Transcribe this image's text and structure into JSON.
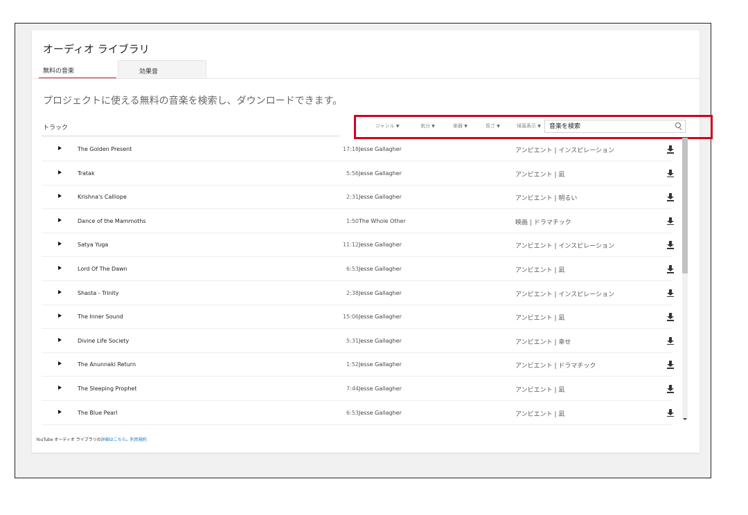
{
  "library": {
    "title": "オーディオ ライブラリ",
    "tabs": [
      {
        "label": "無料の音楽",
        "active": true
      },
      {
        "label": "効果音",
        "active": false
      }
    ],
    "description": "プロジェクトに使える無料の音楽を検索し、ダウンロードできます。"
  },
  "list_header": {
    "track_label": "トラック"
  },
  "filters": [
    {
      "label": "ジャンル"
    },
    {
      "label": "気分"
    },
    {
      "label": "楽器"
    },
    {
      "label": "長さ"
    },
    {
      "label": "帰属表示"
    }
  ],
  "search": {
    "placeholder": "音楽を検索"
  },
  "tracks": [
    {
      "title": "The Golden Present",
      "duration": "17:18",
      "artist": "Jesse Gallagher",
      "genre": "アンビエント | インスピレーション"
    },
    {
      "title": "Tratak",
      "duration": "5:56",
      "artist": "Jesse Gallagher",
      "genre": "アンビエント | 凪"
    },
    {
      "title": "Krishna's Calliope",
      "duration": "2:31",
      "artist": "Jesse Gallagher",
      "genre": "アンビエント | 明るい"
    },
    {
      "title": "Dance of the Mammoths",
      "duration": "1:50",
      "artist": "The Whole Other",
      "genre": "映画 | ドラマチック"
    },
    {
      "title": "Satya Yuga",
      "duration": "11:12",
      "artist": "Jesse Gallagher",
      "genre": "アンビエント | インスピレーション"
    },
    {
      "title": "Lord Of The Dawn",
      "duration": "6:53",
      "artist": "Jesse Gallagher",
      "genre": "アンビエント | 凪"
    },
    {
      "title": "Shasta - Trinity",
      "duration": "2:38",
      "artist": "Jesse Gallagher",
      "genre": "アンビエント | インスピレーション"
    },
    {
      "title": "The Inner Sound",
      "duration": "15:06",
      "artist": "Jesse Gallagher",
      "genre": "アンビエント | 凪"
    },
    {
      "title": "Divine Life Society",
      "duration": "5:31",
      "artist": "Jesse Gallagher",
      "genre": "アンビエント | 幸せ"
    },
    {
      "title": "The Anunnaki Return",
      "duration": "1:52",
      "artist": "Jesse Gallagher",
      "genre": "アンビエント | ドラマチック"
    },
    {
      "title": "The Sleeping Prophet",
      "duration": "7:44",
      "artist": "Jesse Gallagher",
      "genre": "アンビエント | 凪"
    },
    {
      "title": "The Blue Pearl",
      "duration": "6:53",
      "artist": "Jesse Gallagher",
      "genre": "アンビエント | 凪"
    }
  ],
  "footer": {
    "prefix": "YouTube オーディオ ライブラリの",
    "details_link": "詳細はこちら",
    "separator": "。",
    "terms_link": "利用規約"
  },
  "colors": {
    "accent": "#cc181e",
    "highlight": "#d0021b",
    "link": "#167ac6"
  }
}
